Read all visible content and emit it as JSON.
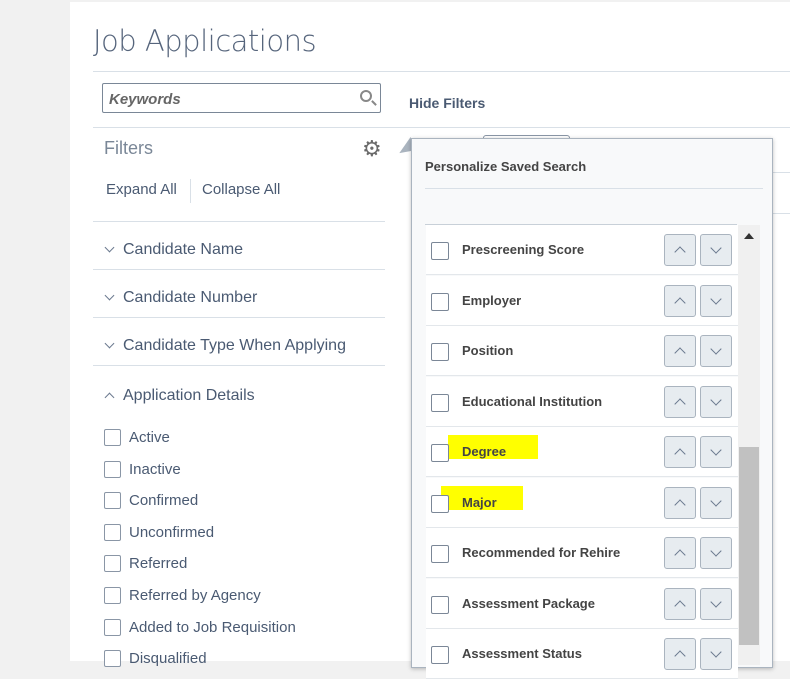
{
  "page": {
    "title": "Job Applications"
  },
  "search": {
    "placeholder": "Keywords"
  },
  "hide_filters": "Hide Filters",
  "filters": {
    "heading": "Filters",
    "expand_all": "Expand All",
    "collapse_all": "Collapse All",
    "sections": [
      "Candidate Name",
      "Candidate Number",
      "Candidate Type When Applying",
      "Application Details"
    ],
    "application_details": [
      "Active",
      "Inactive",
      "Confirmed",
      "Unconfirmed",
      "Referred",
      "Referred by Agency",
      "Added to Job Requisition",
      "Disqualified"
    ]
  },
  "popup": {
    "title": "Personalize Saved Search",
    "items": [
      {
        "label": "Prescreening Score",
        "checked": false,
        "highlighted": false
      },
      {
        "label": "Employer",
        "checked": false,
        "highlighted": false
      },
      {
        "label": "Position",
        "checked": false,
        "highlighted": false
      },
      {
        "label": "Educational Institution",
        "checked": false,
        "highlighted": false
      },
      {
        "label": "Degree",
        "checked": false,
        "highlighted": true
      },
      {
        "label": "Major",
        "checked": false,
        "highlighted": true
      },
      {
        "label": "Recommended for Rehire",
        "checked": false,
        "highlighted": false
      },
      {
        "label": "Assessment Package",
        "checked": false,
        "highlighted": false
      },
      {
        "label": "Assessment Status",
        "checked": false,
        "highlighted": false
      }
    ],
    "highlight_color": "#ffff00"
  }
}
